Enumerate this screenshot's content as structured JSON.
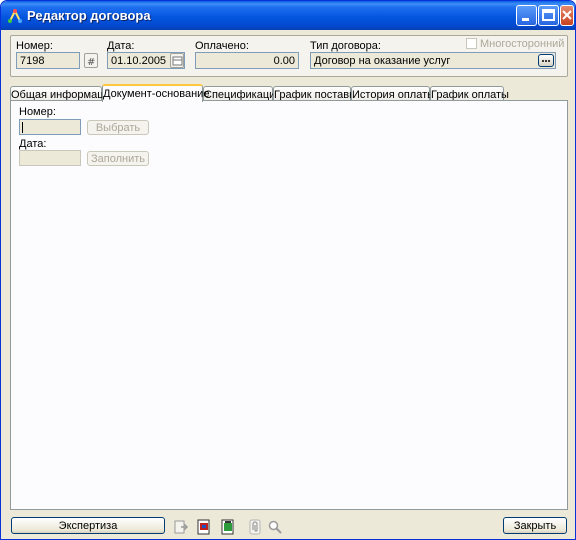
{
  "window": {
    "title": "Редактор договора"
  },
  "header": {
    "number_label": "Номер:",
    "number_value": "7198",
    "date_label": "Дата:",
    "date_value": "01.10.2005",
    "paid_label": "Оплачено:",
    "paid_value": "0.00",
    "contract_type_label": "Тип договора:",
    "contract_type_value": "Договор на оказание услуг",
    "multilateral_label": "Многосторонний",
    "multilateral_checked": false
  },
  "tabs": [
    {
      "label": "Общая информация"
    },
    {
      "label": "Документ-основание"
    },
    {
      "label": "Спецификация"
    },
    {
      "label": "График поставки"
    },
    {
      "label": "История оплаты"
    },
    {
      "label": "График оплаты"
    }
  ],
  "active_tab": "Документ-основание",
  "basis_doc": {
    "number_label": "Номер:",
    "number_value": "",
    "select_button": "Выбрать",
    "date_label": "Дата:",
    "date_value": "",
    "fill_button": "Заполнить"
  },
  "footer": {
    "expertise_button": "Экспертиза",
    "close_button": "Закрыть"
  },
  "icons": [
    "export-icon",
    "document-image-icon",
    "document-green-icon",
    "paperclip-icon",
    "magnifier-icon"
  ]
}
